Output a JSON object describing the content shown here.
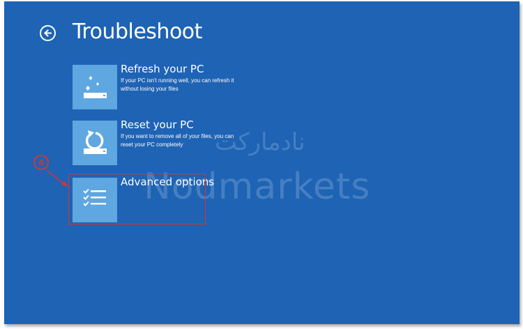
{
  "header": {
    "back_icon": "back-arrow-circle-icon",
    "title": "Troubleshoot"
  },
  "options": [
    {
      "icon": "refresh-pc-icon",
      "title": "Refresh your PC",
      "description": "If your PC isn't running well, you can refresh it without losing your files"
    },
    {
      "icon": "reset-pc-icon",
      "title": "Reset your PC",
      "description": "If you want to remove all of your files, you can reset your PC completely"
    },
    {
      "icon": "checklist-icon",
      "title": "Advanced options",
      "description": ""
    }
  ],
  "annotation": {
    "step_number": "4",
    "color": "#e0312f"
  },
  "watermark": {
    "latin": "Nodmarkets",
    "farsi": "نادمارکت"
  },
  "colors": {
    "background": "#1e63b4",
    "tile": "#5ea7e1",
    "text": "#ffffff"
  }
}
